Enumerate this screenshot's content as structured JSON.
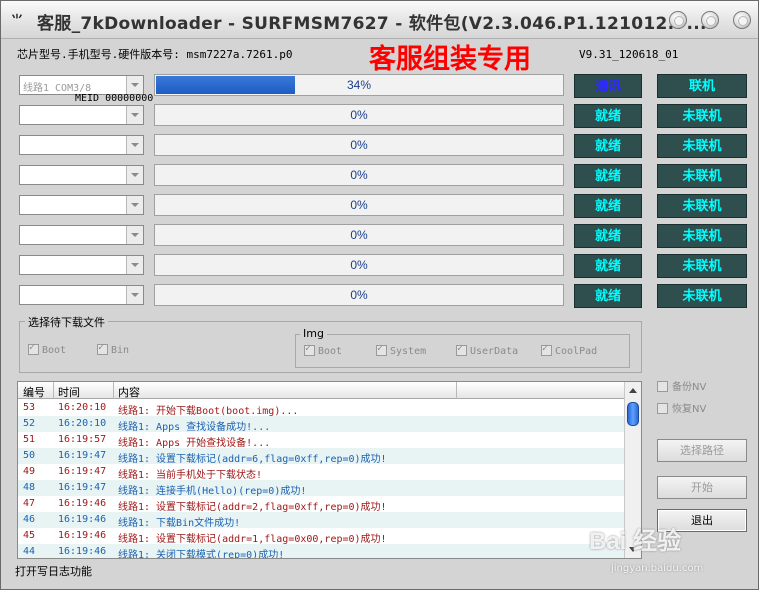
{
  "window": {
    "title": "客服_7kDownloader - SURFMSM7627 - 软件包(V2.3.046.P1.121012.7...",
    "logo": "‬⺌"
  },
  "info": {
    "text": "芯片型号.手机型号.硬件版本号: msm7227a.7261.p0",
    "promo": "客服组装专用",
    "version": "V9.31_120618_01"
  },
  "channels": [
    {
      "port": "线路1  COM3/8",
      "progress": 34,
      "pct_label": "34%",
      "status": "通讯",
      "link": "联机"
    },
    {
      "port": "",
      "progress": 0,
      "pct_label": "0%",
      "status": "就绪",
      "link": "未联机"
    },
    {
      "port": "",
      "progress": 0,
      "pct_label": "0%",
      "status": "就绪",
      "link": "未联机"
    },
    {
      "port": "",
      "progress": 0,
      "pct_label": "0%",
      "status": "就绪",
      "link": "未联机"
    },
    {
      "port": "",
      "progress": 0,
      "pct_label": "0%",
      "status": "就绪",
      "link": "未联机"
    },
    {
      "port": "",
      "progress": 0,
      "pct_label": "0%",
      "status": "就绪",
      "link": "未联机"
    },
    {
      "port": "",
      "progress": 0,
      "pct_label": "0%",
      "status": "就绪",
      "link": "未联机"
    },
    {
      "port": "",
      "progress": 0,
      "pct_label": "0%",
      "status": "就绪",
      "link": "未联机"
    }
  ],
  "meid": "MEID 00000000",
  "download_files": {
    "legend": "选择待下载文件",
    "boot": "Boot",
    "bin": "Bin",
    "img_legend": "Img",
    "img_boot": "Boot",
    "img_system": "System",
    "img_userdata": "UserData",
    "img_coolpad": "CoolPad"
  },
  "log": {
    "headers": {
      "num": "编号",
      "time": "时间",
      "content": "内容"
    },
    "rows": [
      {
        "num": "53",
        "time": "16:20:10",
        "content": "线路1: 开始下载Boot(boot.img)...",
        "color": "red"
      },
      {
        "num": "52",
        "time": "16:20:10",
        "content": "线路1: Apps 查找设备成功!...",
        "color": "blue"
      },
      {
        "num": "51",
        "time": "16:19:57",
        "content": "线路1: Apps 开始查找设备!...",
        "color": "red"
      },
      {
        "num": "50",
        "time": "16:19:47",
        "content": "线路1: 设置下载标记(addr=6,flag=0xff,rep=0)成功!",
        "color": "blue"
      },
      {
        "num": "49",
        "time": "16:19:47",
        "content": "线路1: 当前手机处于下载状态!",
        "color": "red"
      },
      {
        "num": "48",
        "time": "16:19:47",
        "content": "线路1: 连接手机(Hello)(rep=0)成功!",
        "color": "blue"
      },
      {
        "num": "47",
        "time": "16:19:46",
        "content": "线路1: 设置下载标记(addr=2,flag=0xff,rep=0)成功!",
        "color": "red"
      },
      {
        "num": "46",
        "time": "16:19:46",
        "content": "线路1: 下载Bin文件成功!",
        "color": "blue"
      },
      {
        "num": "45",
        "time": "16:19:46",
        "content": "线路1: 设置下载标记(addr=1,flag=0x00,rep=0)成功!",
        "color": "red"
      },
      {
        "num": "44",
        "time": "16:19:46",
        "content": "线路1: 关闭下载模式(rep=0)成功!",
        "color": "blue"
      }
    ]
  },
  "side": {
    "backup_nv": "备份NV",
    "restore_nv": "恢复NV",
    "select_path": "选择路径",
    "start": "开始",
    "exit": "退出"
  },
  "statusbar": {
    "text": "打开写日志功能"
  },
  "watermark": {
    "text": "Bai 经验",
    "sub": "jingyan.baidu.com"
  }
}
